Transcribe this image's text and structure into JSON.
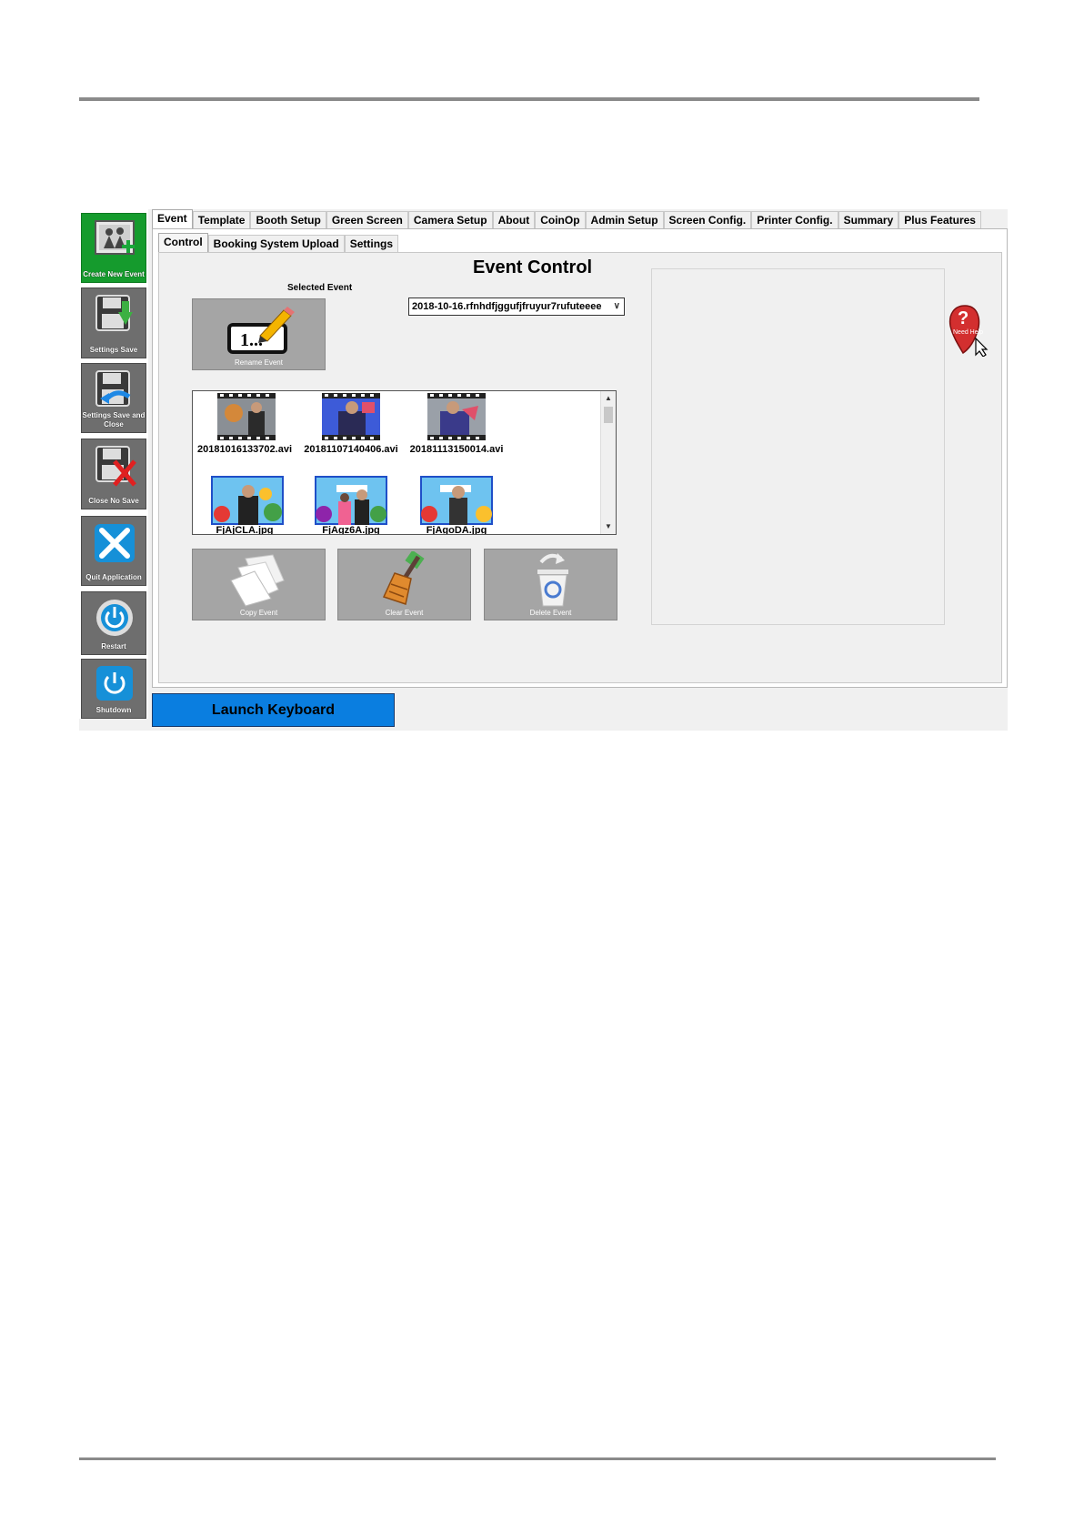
{
  "sidebar": {
    "items": [
      {
        "label": "Create New Event",
        "icon": "create-event-icon"
      },
      {
        "label": "Settings Save",
        "icon": "floppy-download-icon"
      },
      {
        "label": "Settings Save and Close",
        "icon": "floppy-return-icon"
      },
      {
        "label": "Close No Save",
        "icon": "floppy-x-icon"
      },
      {
        "label": "Quit Application",
        "icon": "x-icon"
      },
      {
        "label": "Restart",
        "icon": "restart-icon"
      },
      {
        "label": "Shutdown",
        "icon": "power-icon"
      }
    ]
  },
  "tabs": [
    "Event",
    "Template",
    "Booth Setup",
    "Green Screen",
    "Camera Setup",
    "About",
    "CoinOp",
    "Admin Setup",
    "Screen Config.",
    "Printer Config.",
    "Summary",
    "Plus Features"
  ],
  "subtabs": [
    "Control",
    "Booking System Upload",
    "Settings"
  ],
  "event": {
    "title": "Event Control",
    "selected_label": "Selected Event",
    "selected_value": "2018-10-16.rfnhdfjggufjfruyur7rufuteeee",
    "rename_label": "Rename Event",
    "rename_glyph": "1...",
    "files": [
      "20181016133702.avi",
      "20181107140406.avi",
      "20181113150014.avi",
      "FjAjCLA.jpg",
      "FjAgz6A.jpg",
      "FjAgoDA.jpg"
    ],
    "copy_label": "Copy Event",
    "clear_label": "Clear Event",
    "delete_label": "Delete Event"
  },
  "help": {
    "label": "Need Help"
  },
  "launch_keyboard": "Launch Keyboard",
  "colors": {
    "accent_green": "#159b2d",
    "launch_blue": "#0a7ee0",
    "button_gray": "#a5a5a5",
    "sidebar_gray": "#6e6e6e"
  }
}
